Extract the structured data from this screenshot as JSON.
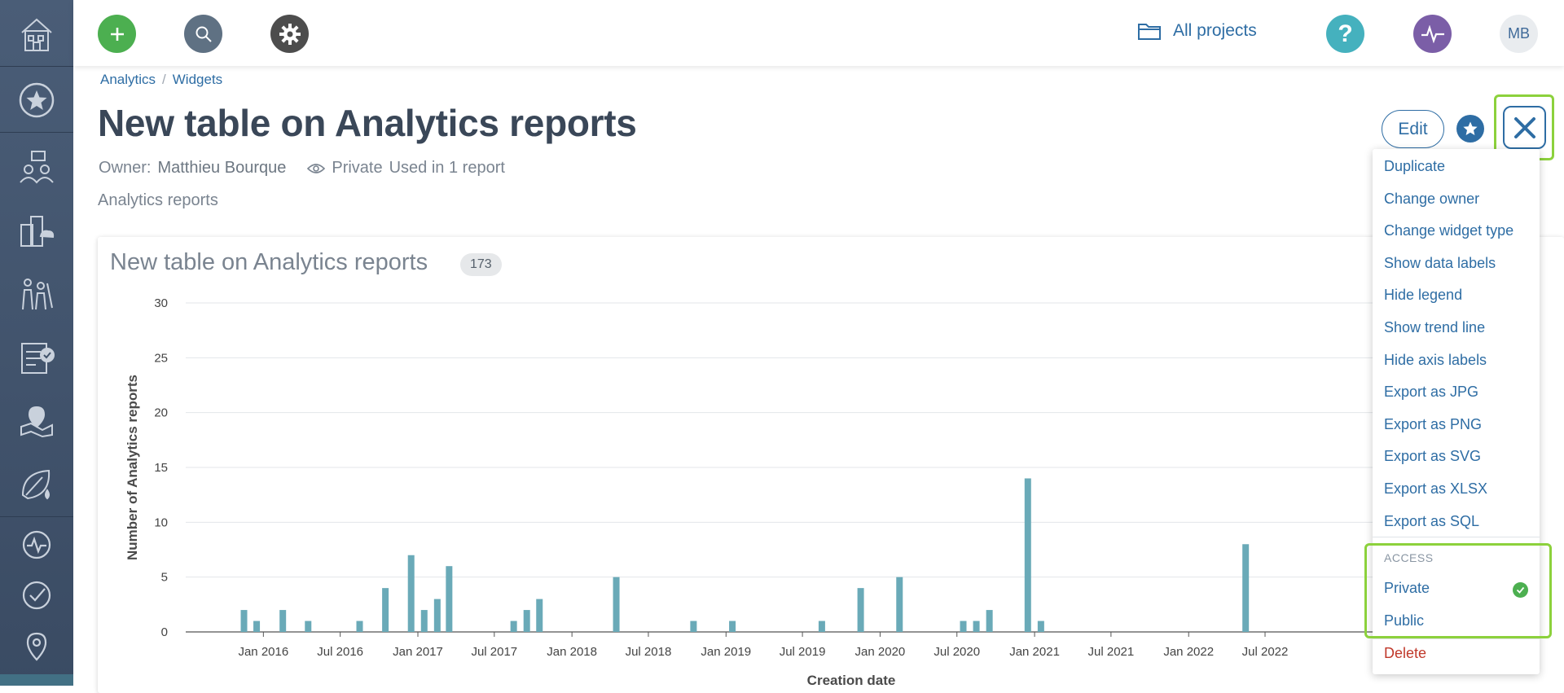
{
  "sidebar": {
    "items": [
      {
        "icon": "home-icon"
      },
      {
        "icon": "star-icon"
      },
      {
        "icon": "people-presentation-icon"
      },
      {
        "icon": "buildings-cloud-icon"
      },
      {
        "icon": "family-icon"
      },
      {
        "icon": "clipboard-check-icon"
      },
      {
        "icon": "map-pin-icon"
      },
      {
        "icon": "leaf-drop-icon"
      },
      {
        "icon": "pulse-icon"
      },
      {
        "icon": "check-circle-icon"
      },
      {
        "icon": "location-icon"
      }
    ]
  },
  "topbar": {
    "add_icon": "plus-icon",
    "search_icon": "search-icon",
    "settings_icon": "gear-icon",
    "projects_label": "All projects",
    "help_label": "?",
    "activity_icon": "pulse-icon",
    "avatar_initials": "MB"
  },
  "breadcrumb": {
    "items": [
      "Analytics",
      "Widgets"
    ],
    "separator": "/"
  },
  "page": {
    "title": "New table on Analytics reports",
    "owner_label": "Owner:",
    "owner_name": "Matthieu Bourque",
    "visibility": "Private",
    "usage": "Used in 1 report",
    "subtitle": "Analytics reports"
  },
  "actions": {
    "edit_label": "Edit"
  },
  "widget": {
    "title": "New table on Analytics reports",
    "count": "173"
  },
  "chart_data": {
    "type": "bar",
    "xlabel": "Creation date",
    "ylabel": "Number of Analytics reports",
    "ylim": [
      0,
      30
    ],
    "y_ticks": [
      "0",
      "5",
      "10",
      "15",
      "20",
      "25",
      "30"
    ],
    "x_ticks": [
      "Jan 2016",
      "Jul 2016",
      "Jan 2017",
      "Jul 2017",
      "Jan 2018",
      "Jul 2018",
      "Jan 2019",
      "Jul 2019",
      "Jan 2020",
      "Jul 2020",
      "Jan 2021",
      "Jul 2021",
      "Jan 2022",
      "Jul 2022"
    ],
    "bars": [
      {
        "x": "2015-11",
        "y": 2
      },
      {
        "x": "2015-12",
        "y": 1
      },
      {
        "x": "2016-02",
        "y": 2
      },
      {
        "x": "2016-04",
        "y": 1
      },
      {
        "x": "2016-08",
        "y": 1
      },
      {
        "x": "2016-10",
        "y": 4
      },
      {
        "x": "2016-12",
        "y": 7
      },
      {
        "x": "2017-01",
        "y": 2
      },
      {
        "x": "2017-02",
        "y": 3
      },
      {
        "x": "2017-03",
        "y": 6
      },
      {
        "x": "2017-08",
        "y": 1
      },
      {
        "x": "2017-09",
        "y": 2
      },
      {
        "x": "2017-10",
        "y": 3
      },
      {
        "x": "2018-04",
        "y": 5
      },
      {
        "x": "2018-10",
        "y": 1
      },
      {
        "x": "2019-01",
        "y": 1
      },
      {
        "x": "2019-08",
        "y": 1
      },
      {
        "x": "2019-11",
        "y": 4
      },
      {
        "x": "2020-02",
        "y": 5
      },
      {
        "x": "2020-07",
        "y": 1
      },
      {
        "x": "2020-08",
        "y": 1
      },
      {
        "x": "2020-09",
        "y": 2
      },
      {
        "x": "2020-12",
        "y": 14
      },
      {
        "x": "2021-01",
        "y": 1
      },
      {
        "x": "2022-05",
        "y": 8
      }
    ],
    "color": "#6aaab8",
    "grid": true,
    "legend": "none"
  },
  "menu": {
    "items": [
      "Duplicate",
      "Change owner",
      "Change widget type",
      "Show data labels",
      "Hide legend",
      "Show trend line",
      "Hide axis labels",
      "Export as JPG",
      "Export as PNG",
      "Export as SVG",
      "Export as XLSX",
      "Export as SQL"
    ],
    "access_header": "ACCESS",
    "access_private": "Private",
    "access_public": "Public",
    "delete_label": "Delete"
  }
}
